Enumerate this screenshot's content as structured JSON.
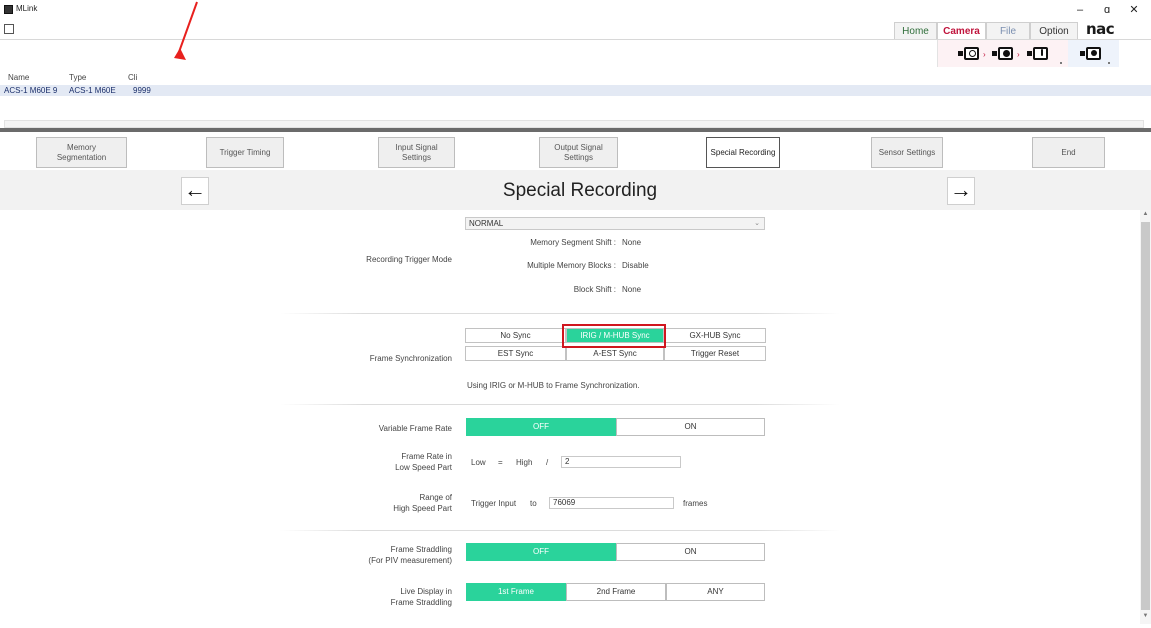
{
  "window": {
    "title": "MLink",
    "minimize": "–",
    "maximize": "ɑ",
    "close": "✕"
  },
  "ribbon": {
    "tabs": [
      "Home",
      "Camera",
      "File",
      "Option"
    ],
    "logo": "nac",
    "icons": [
      "camera-search-icon",
      "camera-record-icon",
      "camera-download-icon",
      "camera-settings-icon"
    ]
  },
  "camera_list": {
    "columns": [
      "Name",
      "Type",
      "Cli"
    ],
    "rows": [
      {
        "name": "ACS-1 M60E 9",
        "type": "ACS-1 M60E",
        "cli": "9999"
      }
    ]
  },
  "steps": [
    "Memory\nSegmentation",
    "Trigger Timing",
    "Input Signal\nSettings",
    "Output Signal\nSettings",
    "Special Recording",
    "Sensor Settings",
    "End"
  ],
  "header": {
    "title": "Special Recording",
    "prev": "←",
    "next": "→"
  },
  "recording_trigger": {
    "label": "Recording Trigger Mode",
    "selected": "NORMAL",
    "caret": "⌄",
    "memory_segment_shift_label": "Memory Segment Shift :",
    "memory_segment_shift_value": "None",
    "multiple_memory_blocks_label": "Multiple Memory Blocks :",
    "multiple_memory_blocks_value": "Disable",
    "block_shift_label": "Block Shift :",
    "block_shift_value": "None"
  },
  "frame_sync": {
    "label": "Frame Synchronization",
    "options": [
      "No Sync",
      "IRIG / M-HUB Sync",
      "GX-HUB Sync",
      "EST Sync",
      "A-EST Sync",
      "Trigger Reset"
    ],
    "selected": "IRIG / M-HUB Sync",
    "description": "Using IRIG or M-HUB to Frame Synchronization."
  },
  "variable_frame_rate": {
    "label": "Variable Frame Rate",
    "off": "OFF",
    "on": "ON",
    "selected": "OFF"
  },
  "frame_rate_low": {
    "label": "Frame Rate in\nLow Speed Part",
    "low": "Low",
    "eq": "=",
    "high": "High",
    "slash": "/",
    "value": "2"
  },
  "range_high": {
    "label": "Range of\nHigh Speed Part",
    "trigger_input": "Trigger Input",
    "to": "to",
    "value": "76069",
    "unit": "frames"
  },
  "frame_straddling": {
    "label": "Frame Straddling\n(For PIV measurement)",
    "off": "OFF",
    "on": "ON",
    "selected": "OFF"
  },
  "live_display": {
    "label": "Live Display in\nFrame Straddling",
    "options": [
      "1st Frame",
      "2nd Frame",
      "ANY"
    ],
    "selected": "1st Frame"
  },
  "colors": {
    "accent_green": "#2ad39b",
    "highlight_red": "#d0161f",
    "camera_tab_red": "#c0143c"
  }
}
